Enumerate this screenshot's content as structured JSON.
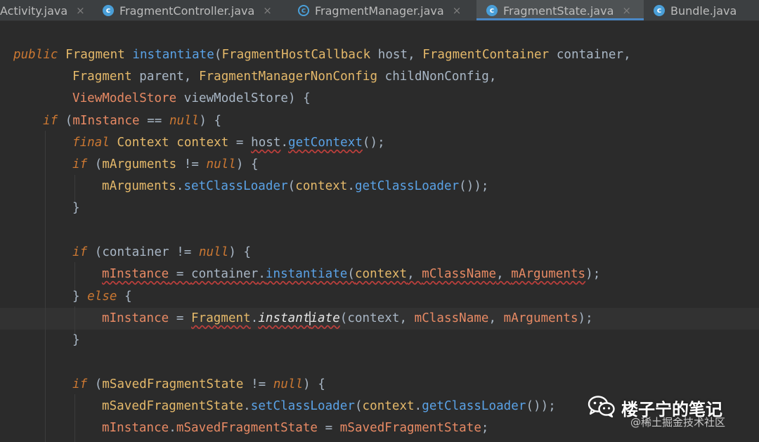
{
  "tabs": [
    {
      "label": "Activity.java",
      "icon": "",
      "active": false
    },
    {
      "label": "FragmentController.java",
      "icon": "class-icon",
      "active": false
    },
    {
      "label": "FragmentManager.java",
      "icon": "abstract-class-icon",
      "active": false
    },
    {
      "label": "FragmentState.java",
      "icon": "class-icon",
      "active": true
    },
    {
      "label": "Bundle.java",
      "icon": "class-icon",
      "active": false
    }
  ],
  "tab_close_glyph": "×",
  "tab_icon_letter": "c",
  "code": {
    "l1": {
      "a": "public",
      "b": "Fragment",
      "c": "instantiate",
      "d": "(",
      "e": "FragmentHostCallback",
      "f": " host, ",
      "g": "FragmentContainer",
      "h": " container,"
    },
    "l2": {
      "a": "Fragment",
      "b": " parent, ",
      "c": "FragmentManagerNonConfig",
      "d": " childNonConfig,"
    },
    "l3": {
      "a": "ViewModelStore",
      "b": " viewModelStore) {"
    },
    "l4": {
      "a": "if",
      "b": " (",
      "c": "mInstance",
      "d": " == ",
      "e": "null",
      "f": ") {"
    },
    "l5": {
      "a": "final",
      "b": "Context",
      "c": "context",
      "d": " = ",
      "e": "host",
      "f": ".",
      "g": "getContext",
      "h": "();"
    },
    "l6": {
      "a": "if",
      "b": " (",
      "c": "mArguments",
      "d": " != ",
      "e": "null",
      "f": ") {"
    },
    "l7": {
      "a": "mArguments",
      "b": ".",
      "c": "setClassLoader",
      "d": "(",
      "e": "context",
      "f": ".",
      "g": "getClassLoader",
      "h": "());"
    },
    "l8": {
      "a": "}"
    },
    "l9": {
      "a": "if",
      "b": " (container ",
      "c": "!=",
      "d": " ",
      "e": "null",
      "f": ") {"
    },
    "l10": {
      "a": "mInstance",
      "b": " = ",
      "c": "container",
      "d": ".",
      "e": "instantiate",
      "f": "(",
      "g": "context",
      "h": ", ",
      "i": "mClassName",
      "j": ", ",
      "k": "mArguments",
      "l": ");"
    },
    "l11": {
      "a": "} ",
      "b": "else",
      "c": " {"
    },
    "l12": {
      "a": "mInstance",
      "b": " = ",
      "c": "Fragment",
      "d": ".",
      "e1": "instant",
      "e2": "iate",
      "f": "(context, ",
      "g": "mClassName",
      "h": ", ",
      "i": "mArguments",
      "j": ");"
    },
    "l13": {
      "a": "}"
    },
    "l14": {
      "a": "if",
      "b": " (",
      "c": "mSavedFragmentState",
      "d": " != ",
      "e": "null",
      "f": ") {"
    },
    "l15": {
      "a": "mSavedFragmentState",
      "b": ".",
      "c": "setClassLoader",
      "d": "(",
      "e": "context",
      "f": ".",
      "g": "getClassLoader",
      "h": "());"
    },
    "l16": {
      "a": "mInstance",
      "b": ".",
      "c": "mSavedFragmentState",
      "d": " = ",
      "e": "mSavedFragmentState",
      "f": ";"
    }
  },
  "colors": {
    "background": "#2b2b2b",
    "keyword": "#cc7832",
    "type": "#e5b96a",
    "method": "#5aa2e6",
    "field": "#e88a64",
    "active_tab_underline": "#4a88c7"
  },
  "watermark": {
    "title": "楼子宁的笔记",
    "subtitle": "@稀土掘金技术社区",
    "icon": "wechat-icon"
  }
}
